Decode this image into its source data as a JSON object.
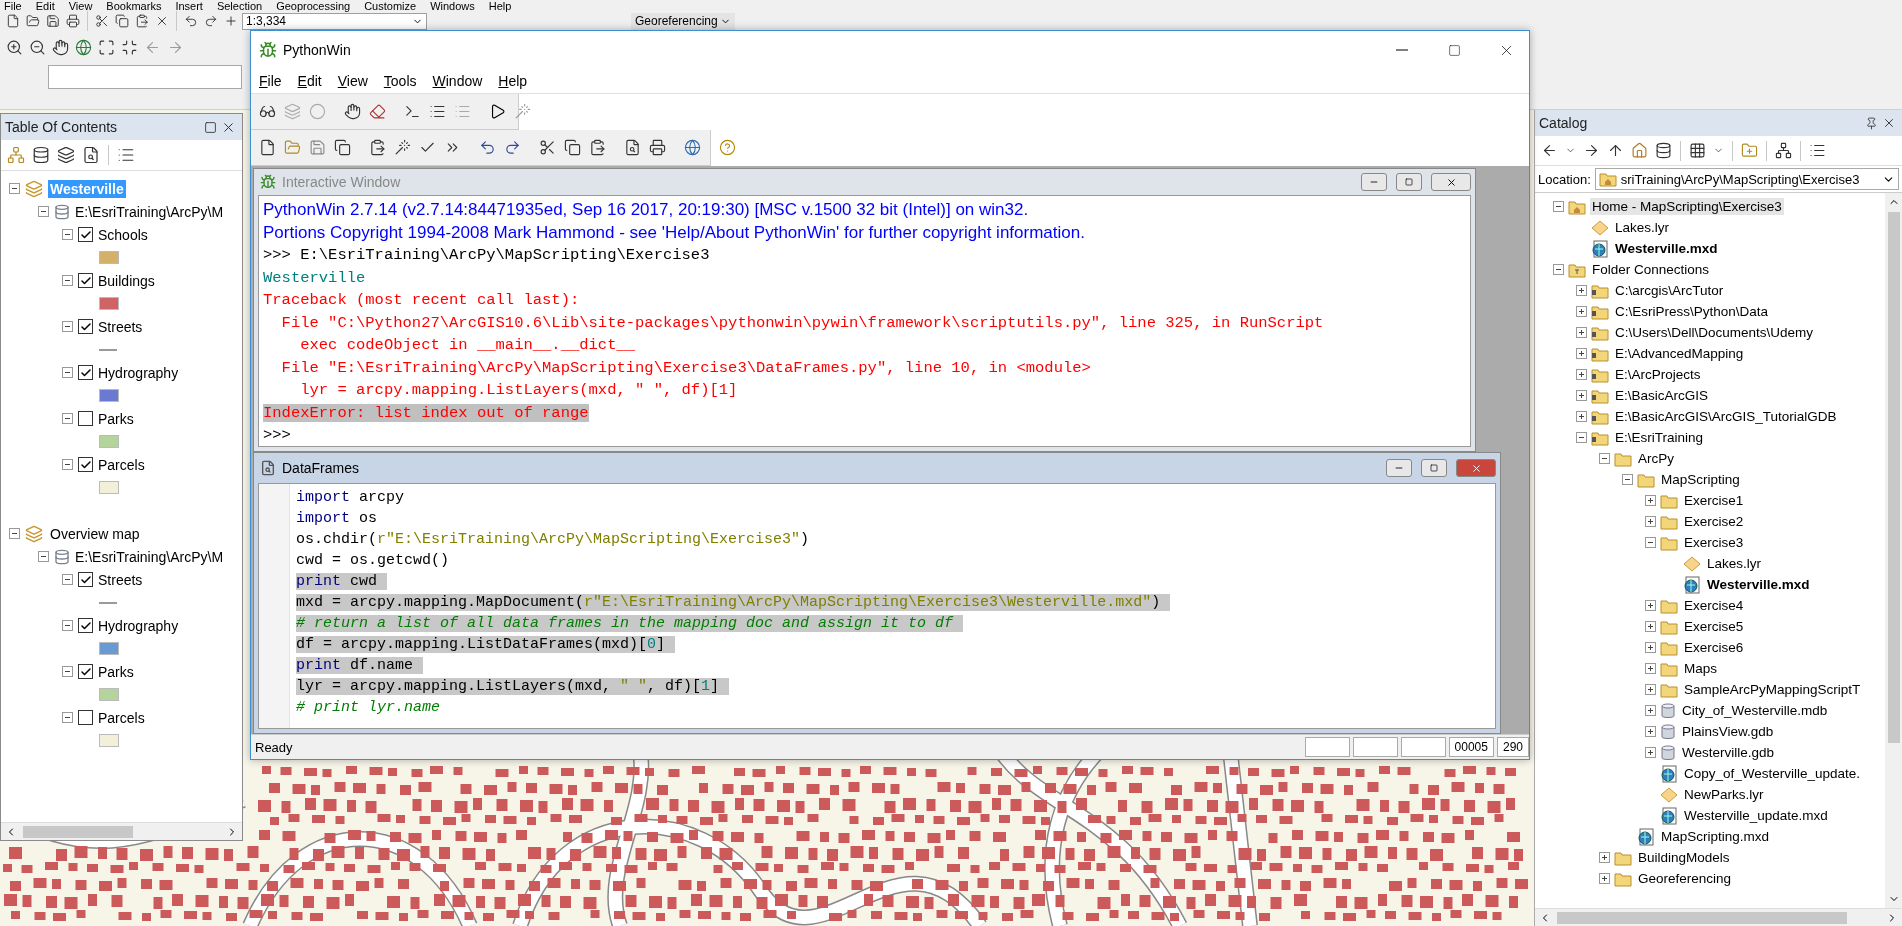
{
  "arcmap": {
    "menu": [
      "File",
      "Edit",
      "View",
      "Bookmarks",
      "Insert",
      "Selection",
      "Geoprocessing",
      "Customize",
      "Windows",
      "Help"
    ],
    "scale": "1:3,334",
    "georeferencing": "Georeferencing"
  },
  "toc": {
    "title": "Table Of Contents",
    "frames": [
      {
        "name": "Westerville",
        "selected": true,
        "expanded": true,
        "source": {
          "path": "E:\\EsriTraining\\ArcPy\\M",
          "expanded": true
        },
        "layers": [
          {
            "name": "Schools",
            "checked": true,
            "expanded": true,
            "kind": "fill",
            "color": "#d4b06a"
          },
          {
            "name": "Buildings",
            "checked": true,
            "expanded": true,
            "kind": "fill",
            "color": "#d06464"
          },
          {
            "name": "Streets",
            "checked": true,
            "expanded": true,
            "kind": "line",
            "color": "#9a9a9a"
          },
          {
            "name": "Hydrography",
            "checked": true,
            "expanded": true,
            "kind": "fill",
            "color": "#6a7ad0"
          },
          {
            "name": "Parks",
            "checked": false,
            "expanded": true,
            "kind": "fill",
            "color": "#b4d49c"
          },
          {
            "name": "Parcels",
            "checked": true,
            "expanded": true,
            "kind": "fill",
            "color": "#f2f0d8"
          }
        ]
      },
      {
        "name": "Overview map",
        "selected": false,
        "expanded": true,
        "source": {
          "path": "E:\\EsriTraining\\ArcPy\\M",
          "expanded": true
        },
        "layers": [
          {
            "name": "Streets",
            "checked": true,
            "expanded": true,
            "kind": "line",
            "color": "#9a9a9a"
          },
          {
            "name": "Hydrography",
            "checked": true,
            "expanded": true,
            "kind": "fill",
            "color": "#6a9ad4"
          },
          {
            "name": "Parks",
            "checked": true,
            "expanded": true,
            "kind": "fill",
            "color": "#b4d49c"
          },
          {
            "name": "Parcels",
            "checked": false,
            "expanded": true,
            "kind": "fill",
            "color": "#f2f0d8"
          }
        ]
      }
    ]
  },
  "pythonwin": {
    "title": "PythonWin",
    "menu": [
      "File",
      "Edit",
      "View",
      "Tools",
      "Window",
      "Help"
    ],
    "interactive": {
      "title": "Interactive Window",
      "lines": [
        {
          "kind": "banner",
          "text": "PythonWin 2.7.14 (v2.7.14:84471935ed, Sep 16 2017, 20:19:30) [MSC v.1500 32 bit (Intel)] on win32.",
          "highlighted": false
        },
        {
          "kind": "banner",
          "text": "Portions Copyright 1994-2008 Mark Hammond - see 'Help/About PythonWin' for further copyright information.",
          "highlighted": false
        },
        {
          "kind": "prompt",
          "text": ">>> E:\\EsriTraining\\ArcPy\\MapScripting\\Exercise3",
          "highlighted": false
        },
        {
          "kind": "output",
          "text": "Westerville",
          "highlighted": false
        },
        {
          "kind": "error",
          "text": "Traceback (most recent call last):",
          "highlighted": false
        },
        {
          "kind": "error",
          "text": "  File \"C:\\Python27\\ArcGIS10.6\\Lib\\site-packages\\pythonwin\\pywin\\framework\\scriptutils.py\", line 325, in RunScript",
          "highlighted": false
        },
        {
          "kind": "error",
          "text": "    exec codeObject in __main__.__dict__",
          "highlighted": false
        },
        {
          "kind": "error",
          "text": "  File \"E:\\EsriTraining\\ArcPy\\MapScripting\\Exercise3\\DataFrames.py\", line 10, in <module>",
          "highlighted": false
        },
        {
          "kind": "error",
          "text": "    lyr = arcpy.mapping.ListLayers(mxd, \" \", df)[1]",
          "highlighted": false
        },
        {
          "kind": "error",
          "text": "IndexError: list index out of range",
          "highlighted": true
        },
        {
          "kind": "prompt",
          "text": ">>>",
          "highlighted": false
        }
      ]
    },
    "editor": {
      "title": "DataFrames",
      "lines": [
        {
          "selected": false,
          "tokens": [
            {
              "kind": "keyword",
              "text": "import"
            },
            {
              "kind": "plain",
              "text": " arcpy"
            }
          ]
        },
        {
          "selected": false,
          "tokens": [
            {
              "kind": "keyword",
              "text": "import"
            },
            {
              "kind": "plain",
              "text": " os"
            }
          ]
        },
        {
          "selected": false,
          "tokens": [
            {
              "kind": "plain",
              "text": "os.chdir("
            },
            {
              "kind": "string",
              "text": "r\"E:\\EsriTraining\\ArcPy\\MapScripting\\Exercise3\""
            },
            {
              "kind": "plain",
              "text": ")"
            }
          ]
        },
        {
          "selected": false,
          "tokens": [
            {
              "kind": "plain",
              "text": "cwd = os.getcwd()"
            }
          ]
        },
        {
          "selected": true,
          "tokens": [
            {
              "kind": "keyword",
              "text": "print"
            },
            {
              "kind": "plain",
              "text": " cwd"
            }
          ]
        },
        {
          "selected": true,
          "tokens": [
            {
              "kind": "plain",
              "text": "mxd = arcpy.mapping.MapDocument("
            },
            {
              "kind": "string",
              "text": "r\"E:\\EsriTraining\\ArcPy\\MapScripting\\Exercise3\\Westerville.mxd\""
            },
            {
              "kind": "plain",
              "text": ")"
            }
          ]
        },
        {
          "selected": true,
          "tokens": [
            {
              "kind": "comment",
              "text": "# return a list of all data frames in the mapping doc and assign it to df"
            }
          ]
        },
        {
          "selected": true,
          "tokens": [
            {
              "kind": "plain",
              "text": "df = arcpy.mapping.ListDataFrames(mxd)["
            },
            {
              "kind": "number",
              "text": "0"
            },
            {
              "kind": "plain",
              "text": "]"
            }
          ]
        },
        {
          "selected": true,
          "tokens": [
            {
              "kind": "keyword",
              "text": "print"
            },
            {
              "kind": "plain",
              "text": " df.name"
            }
          ]
        },
        {
          "selected": true,
          "tokens": [
            {
              "kind": "plain",
              "text": "lyr = arcpy.mapping.ListLayers(mxd, "
            },
            {
              "kind": "string",
              "text": "\" \""
            },
            {
              "kind": "plain",
              "text": ", df)["
            },
            {
              "kind": "number",
              "text": "1"
            },
            {
              "kind": "plain",
              "text": "]"
            }
          ]
        },
        {
          "selected": false,
          "tokens": [
            {
              "kind": "comment",
              "text": "# print lyr.name"
            }
          ]
        }
      ]
    },
    "status": {
      "text": "Ready",
      "cells": [
        "00005",
        "290"
      ]
    }
  },
  "catalog": {
    "title": "Catalog",
    "location_label": "Location:",
    "location": "sriTraining\\ArcPy\\MapScripting\\Exercise3",
    "tree": [
      {
        "name": "Home - MapScripting\\Exercise3",
        "kind": "home",
        "selected": true,
        "expanded": true,
        "children": [
          {
            "name": "Lakes.lyr",
            "kind": "lyr",
            "selected": false
          },
          {
            "name": "Westerville.mxd",
            "kind": "mxd",
            "selected": false,
            "current": true
          }
        ]
      },
      {
        "name": "Folder Connections",
        "kind": "connections",
        "selected": false,
        "expanded": true,
        "children": [
          {
            "name": "C:\\arcgis\\ArcTutor",
            "kind": "connection",
            "selected": false,
            "expanded": false
          },
          {
            "name": "C:\\EsriPress\\Python\\Data",
            "kind": "connection",
            "selected": false,
            "expanded": false
          },
          {
            "name": "C:\\Users\\Dell\\Documents\\Udemy",
            "kind": "connection",
            "selected": false,
            "expanded": false
          },
          {
            "name": "E:\\AdvancedMapping",
            "kind": "connection",
            "selected": false,
            "expanded": false
          },
          {
            "name": "E:\\ArcProjects",
            "kind": "connection",
            "selected": false,
            "expanded": false
          },
          {
            "name": "E:\\BasicArcGIS",
            "kind": "connection",
            "selected": false,
            "expanded": false
          },
          {
            "name": "E:\\BasicArcGIS\\ArcGIS_TutorialGDB",
            "kind": "connection",
            "selected": false,
            "expanded": false
          },
          {
            "name": "E:\\EsriTraining",
            "kind": "connection",
            "selected": false,
            "expanded": true,
            "children": [
              {
                "name": "ArcPy",
                "kind": "folder",
                "selected": false,
                "expanded": true,
                "children": [
                  {
                    "name": "MapScripting",
                    "kind": "folder",
                    "selected": false,
                    "expanded": true,
                    "children": [
                      {
                        "name": "Exercise1",
                        "kind": "folder",
                        "selected": false,
                        "expanded": false
                      },
                      {
                        "name": "Exercise2",
                        "kind": "folder",
                        "selected": false,
                        "expanded": false
                      },
                      {
                        "name": "Exercise3",
                        "kind": "folder",
                        "selected": false,
                        "expanded": true,
                        "children": [
                          {
                            "name": "Lakes.lyr",
                            "kind": "lyr",
                            "selected": false
                          },
                          {
                            "name": "Westerville.mxd",
                            "kind": "mxd",
                            "selected": false,
                            "current": true
                          }
                        ]
                      },
                      {
                        "name": "Exercise4",
                        "kind": "folder",
                        "selected": false,
                        "expanded": false
                      },
                      {
                        "name": "Exercise5",
                        "kind": "folder",
                        "selected": false,
                        "expanded": false
                      },
                      {
                        "name": "Exercise6",
                        "kind": "folder",
                        "selected": false,
                        "expanded": false
                      },
                      {
                        "name": "Maps",
                        "kind": "folder",
                        "selected": false,
                        "expanded": false
                      },
                      {
                        "name": "SampleArcPyMappingScriptT",
                        "kind": "folder",
                        "selected": false,
                        "expanded": false
                      },
                      {
                        "name": "City_of_Westerville.mdb",
                        "kind": "gdb",
                        "selected": false,
                        "expanded": false
                      },
                      {
                        "name": "PlainsView.gdb",
                        "kind": "gdb",
                        "selected": false,
                        "expanded": false
                      },
                      {
                        "name": "Westerville.gdb",
                        "kind": "gdb",
                        "selected": false,
                        "expanded": false
                      },
                      {
                        "name": "Copy_of_Westerville_update.",
                        "kind": "mxd",
                        "selected": false,
                        "current": false
                      },
                      {
                        "name": "NewParks.lyr",
                        "kind": "lyr",
                        "selected": false
                      },
                      {
                        "name": "Westerville_update.mxd",
                        "kind": "mxd",
                        "selected": false,
                        "current": false
                      }
                    ]
                  },
                  {
                    "name": "MapScripting.mxd",
                    "kind": "mxd",
                    "selected": false,
                    "current": false
                  }
                ]
              },
              {
                "name": "BuildingModels",
                "kind": "folder",
                "selected": false,
                "expanded": false
              },
              {
                "name": "Georeferencing",
                "kind": "folder",
                "selected": false,
                "expanded": false
              }
            ]
          }
        ]
      }
    ]
  }
}
